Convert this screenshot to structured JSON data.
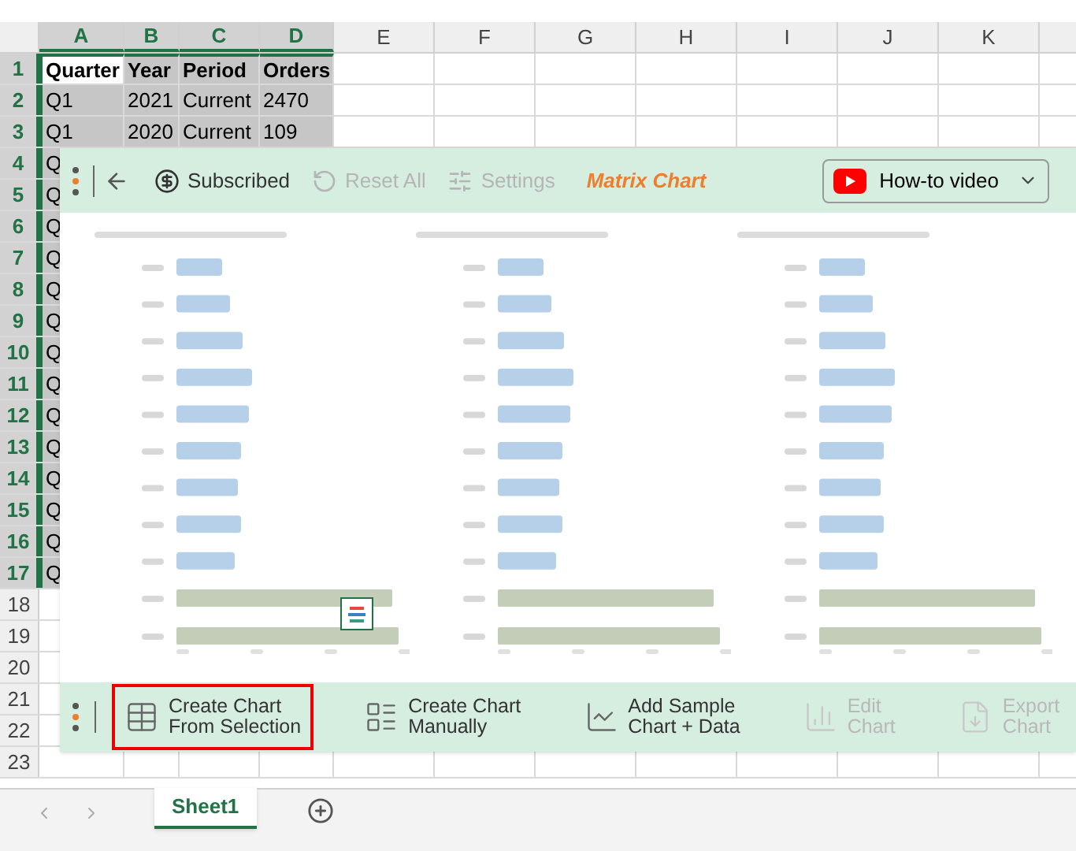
{
  "columns": [
    {
      "label": "A",
      "selected": true
    },
    {
      "label": "B",
      "selected": true
    },
    {
      "label": "C",
      "selected": true
    },
    {
      "label": "D",
      "selected": true
    },
    {
      "label": "E",
      "selected": false
    },
    {
      "label": "F",
      "selected": false
    },
    {
      "label": "G",
      "selected": false
    },
    {
      "label": "H",
      "selected": false
    },
    {
      "label": "I",
      "selected": false
    },
    {
      "label": "J",
      "selected": false
    },
    {
      "label": "K",
      "selected": false
    }
  ],
  "rows": [
    {
      "label": "1",
      "selected": true,
      "header": true,
      "cells": [
        {
          "text": "Quarter",
          "active": true
        },
        {
          "text": "Year",
          "active": false
        },
        {
          "text": "Period",
          "active": false
        },
        {
          "text": "Orders",
          "active": false
        }
      ]
    },
    {
      "label": "2",
      "selected": true,
      "cells": [
        {
          "text": "Q1",
          "active": false
        },
        {
          "text": "2021",
          "active": false
        },
        {
          "text": "Current",
          "active": false
        },
        {
          "text": "2470",
          "active": false
        }
      ]
    },
    {
      "label": "3",
      "selected": true,
      "cells": [
        {
          "text": "Q1",
          "active": false
        },
        {
          "text": "2020",
          "active": false
        },
        {
          "text": "Current",
          "active": false
        },
        {
          "text": "109",
          "active": false
        }
      ]
    },
    {
      "label": "4",
      "selected": true,
      "cells": [
        {
          "text": "Q",
          "active": false
        }
      ]
    },
    {
      "label": "5",
      "selected": true,
      "cells": [
        {
          "text": "Q",
          "active": false
        }
      ]
    },
    {
      "label": "6",
      "selected": true,
      "cells": [
        {
          "text": "Q",
          "active": false
        }
      ]
    },
    {
      "label": "7",
      "selected": true,
      "cells": [
        {
          "text": "Q",
          "active": false
        }
      ]
    },
    {
      "label": "8",
      "selected": true,
      "cells": [
        {
          "text": "Q",
          "active": false
        }
      ]
    },
    {
      "label": "9",
      "selected": true,
      "cells": [
        {
          "text": "Q",
          "active": false
        }
      ]
    },
    {
      "label": "10",
      "selected": true,
      "cells": [
        {
          "text": "Q",
          "active": false
        }
      ]
    },
    {
      "label": "11",
      "selected": true,
      "cells": [
        {
          "text": "Q",
          "active": false
        }
      ]
    },
    {
      "label": "12",
      "selected": true,
      "cells": [
        {
          "text": "Q",
          "active": false
        }
      ]
    },
    {
      "label": "13",
      "selected": true,
      "cells": [
        {
          "text": "Q",
          "active": false
        }
      ]
    },
    {
      "label": "14",
      "selected": true,
      "cells": [
        {
          "text": "Q",
          "active": false
        }
      ]
    },
    {
      "label": "15",
      "selected": true,
      "cells": [
        {
          "text": "Q",
          "active": false
        }
      ]
    },
    {
      "label": "16",
      "selected": true,
      "cells": [
        {
          "text": "Q",
          "active": false
        }
      ]
    },
    {
      "label": "17",
      "selected": true,
      "cells": [
        {
          "text": "Q",
          "active": false
        }
      ]
    },
    {
      "label": "18",
      "selected": false
    },
    {
      "label": "19",
      "selected": false
    },
    {
      "label": "20",
      "selected": false
    },
    {
      "label": "21",
      "selected": false
    },
    {
      "label": "22",
      "selected": false
    },
    {
      "label": "23",
      "selected": false
    }
  ],
  "panel": {
    "toolbar": {
      "items": [
        {
          "kind": "subscription",
          "label": "Subscribed",
          "disabled": false
        },
        {
          "kind": "reset",
          "label": "Reset All",
          "disabled": true
        },
        {
          "kind": "settings",
          "label": "Settings",
          "disabled": true
        }
      ],
      "title": "Matrix Chart",
      "video_button": "How-to video"
    },
    "actions": [
      {
        "kind": "selection",
        "lines": [
          "Create Chart",
          "From Selection"
        ],
        "selected": true,
        "disabled": false
      },
      {
        "kind": "manual",
        "lines": [
          "Create Chart",
          "Manually"
        ],
        "selected": false,
        "disabled": false
      },
      {
        "kind": "sample",
        "lines": [
          "Add Sample",
          "Chart + Data"
        ],
        "selected": false,
        "disabled": false
      },
      {
        "kind": "edit",
        "lines": [
          "Edit",
          "Chart"
        ],
        "selected": false,
        "disabled": true
      },
      {
        "kind": "export",
        "lines": [
          "Export",
          "Chart"
        ],
        "selected": false,
        "disabled": true
      }
    ]
  },
  "sheet_tabs": [
    {
      "label": "Sheet1",
      "selected": true
    }
  ]
}
